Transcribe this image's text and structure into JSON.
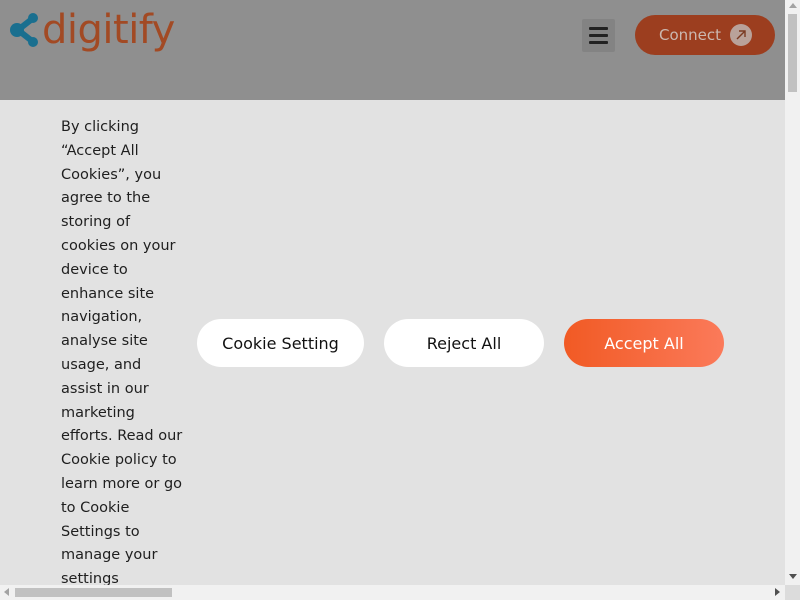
{
  "header": {
    "logo_text": "digitify",
    "connect_label": "Connect",
    "menu_icon": "hamburger-menu-icon",
    "connect_icon": "arrow-up-right-icon"
  },
  "cookie_banner": {
    "message": "By clicking “Accept All Cookies”, you agree to the storing of cookies on your device to enhance site navigation, analyse site usage, and assist in our marketing efforts. Read our Cookie policy to learn more or go to Cookie Settings to manage your settings",
    "settings_label": "Cookie Setting",
    "reject_label": "Reject All",
    "accept_label": "Accept All"
  },
  "colors": {
    "brand": "#f15a24",
    "accent_blue": "#1a8fc0",
    "overlay_gray": "#8f8f8f"
  }
}
